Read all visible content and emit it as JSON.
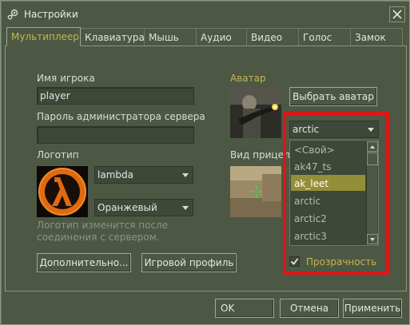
{
  "window": {
    "title": "Настройки"
  },
  "tabs": [
    {
      "label": "Мультиплеер",
      "active": true
    },
    {
      "label": "Клавиатура"
    },
    {
      "label": "Мышь"
    },
    {
      "label": "Аудио"
    },
    {
      "label": "Видео"
    },
    {
      "label": "Голос"
    },
    {
      "label": "Замок"
    }
  ],
  "multiplayer": {
    "player_name_label": "Имя игрока",
    "player_name_value": "player",
    "admin_password_label": "Пароль администратора сервера",
    "admin_password_value": "",
    "logo_label": "Логотип",
    "logo_select": "lambda",
    "logo_color_select": "Оранжевый",
    "logo_note": "Логотип изменится после соединения с сервером.",
    "advanced_button": "Дополнительно...",
    "game_profile_button": "Игровой профиль",
    "avatar_label": "Аватар",
    "choose_avatar_button": "Выбрать аватар",
    "crosshair_label": "Вид прицел",
    "crosshair_select": "arctic",
    "crosshair_options": [
      "<Свой>",
      "ak47_ts",
      "ak_leet",
      "arctic",
      "arctic2",
      "arctic3"
    ],
    "crosshair_selected_index": 2,
    "transparency_label": "Прозрачность",
    "transparency_checked": true
  },
  "footer": {
    "ok_button": "OK",
    "cancel_button": "Отмена",
    "apply_button": "Применить"
  },
  "colors": {
    "background": "#4c5844",
    "accent_yellow": "#c4b550",
    "selection": "#958e38",
    "highlight_frame": "#e01414"
  }
}
